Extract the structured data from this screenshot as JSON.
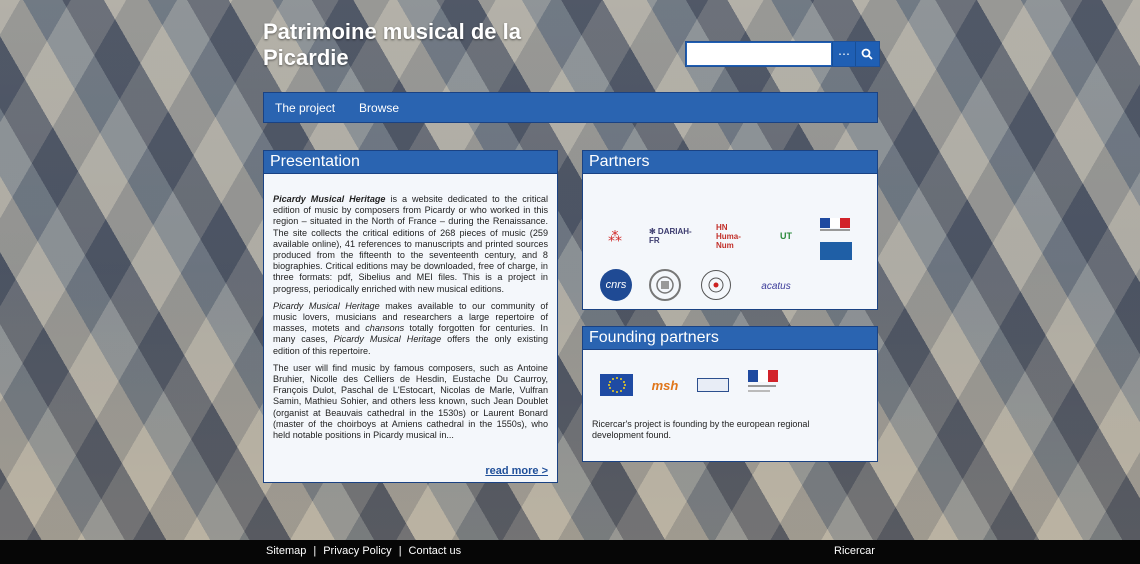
{
  "site": {
    "title": "Patrimoine musical de la Picardie"
  },
  "search": {
    "placeholder": "",
    "more_glyph": "⋯",
    "search_glyph": "⌕"
  },
  "nav": {
    "items": [
      "The project",
      "Browse"
    ]
  },
  "presentation": {
    "heading": "Presentation",
    "p1_em": "Picardy Musical Heritage",
    "p1_rest": " is a website dedicated to the critical edition of music by composers from Picardy or who worked in this region – situated in the North of France – during the Renaissance. The site collects the critical editions of 268 pieces of music (259 available online), 41 references to manuscripts and printed sources produced from the fifteenth to the seventeenth century, and 8 biographies. Critical editions may be downloaded, free of charge, in three formats: pdf, Sibelius and MEI files. This is a project in progress, periodically enriched with new musical editions.",
    "p2_em": "Picardy Musical Heritage",
    "p2_mid1": " makes available to our community of music lovers, musicians and researchers a large repertoire of masses, motets and ",
    "p2_em2": "chansons",
    "p2_mid2": " totally forgotten for centuries. In many cases, ",
    "p2_em3": "Picardy Musical Heritage",
    "p2_end": " offers the only existing edition of this repertoire.",
    "p3": "The user will find music by famous composers, such as Antoine Bruhier, Nicolle des Celliers de Hesdin, Eustache Du Caurroy, François Dulot, Paschal de L'Estocart, Nicolas de Marle, Vulfran Samin, Mathieu Sohier, and others less known, such Jean Doublet (organist at Beauvais cathedral in the 1530s) or Laurent Bonard (master of the choirboys at Amiens cathedral in the 1550s), who held notable positions in Picardy musical in...",
    "read_more": "read more >"
  },
  "partners": {
    "heading": "Partners",
    "logos": [
      {
        "name": "cesr-logo",
        "text": "⁂"
      },
      {
        "name": "dariah-fr-logo",
        "text": "✻ DARIAH-FR"
      },
      {
        "name": "huma-num-logo",
        "text": "HN Huma-Num"
      },
      {
        "name": "ut-tours-logo",
        "text": "UT"
      },
      {
        "name": "ministere-culture-logo",
        "text": ""
      },
      {
        "name": "cnrs-logo",
        "text": "cnrs"
      },
      {
        "name": "university-seal-logo",
        "text": ""
      },
      {
        "name": "ensemble-seal-logo",
        "text": ""
      },
      {
        "name": "acatus-logo",
        "text": "acatus"
      }
    ]
  },
  "founding": {
    "heading": "Founding partners",
    "logos": [
      {
        "name": "eu-flag-logo",
        "text": ""
      },
      {
        "name": "msh-logo",
        "text": "msh"
      },
      {
        "name": "centre-val-de-loire-logo",
        "text": ""
      },
      {
        "name": "republique-francaise-logo",
        "text": ""
      }
    ],
    "text": "Ricercar's project is founding by the european regional development found."
  },
  "footer": {
    "links": [
      "Sitemap",
      "Privacy Policy",
      "Contact us"
    ],
    "separator": "|",
    "right": "Ricercar"
  },
  "colors": {
    "primary": "#2a64b1",
    "border": "#1a4283",
    "footer": "#060606"
  }
}
